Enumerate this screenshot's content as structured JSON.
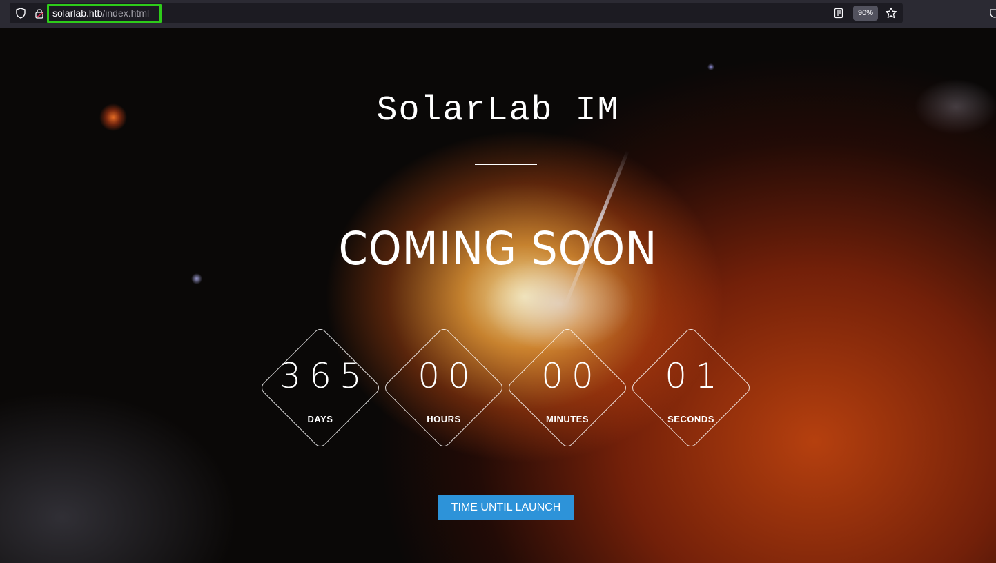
{
  "browser": {
    "url_host": "solarlab.htb",
    "url_path": "/index.html",
    "zoom": "90%",
    "icons": [
      "shield-icon",
      "lock-icon",
      "reader-view-icon",
      "bookmark-star-icon",
      "pocket-icon"
    ]
  },
  "page": {
    "site_title": "SolarLab IM",
    "headline": "COMING SOON",
    "countdown": [
      {
        "value": "365",
        "label": "DAYS"
      },
      {
        "value": "00",
        "label": "HOURS"
      },
      {
        "value": "00",
        "label": "MINUTES"
      },
      {
        "value": "01",
        "label": "SECONDS"
      }
    ],
    "button_label": "TIME UNTIL LAUNCH"
  },
  "colors": {
    "url_highlight": "#2ecc1a",
    "button": "#2d93d9",
    "text": "#ffffff"
  }
}
